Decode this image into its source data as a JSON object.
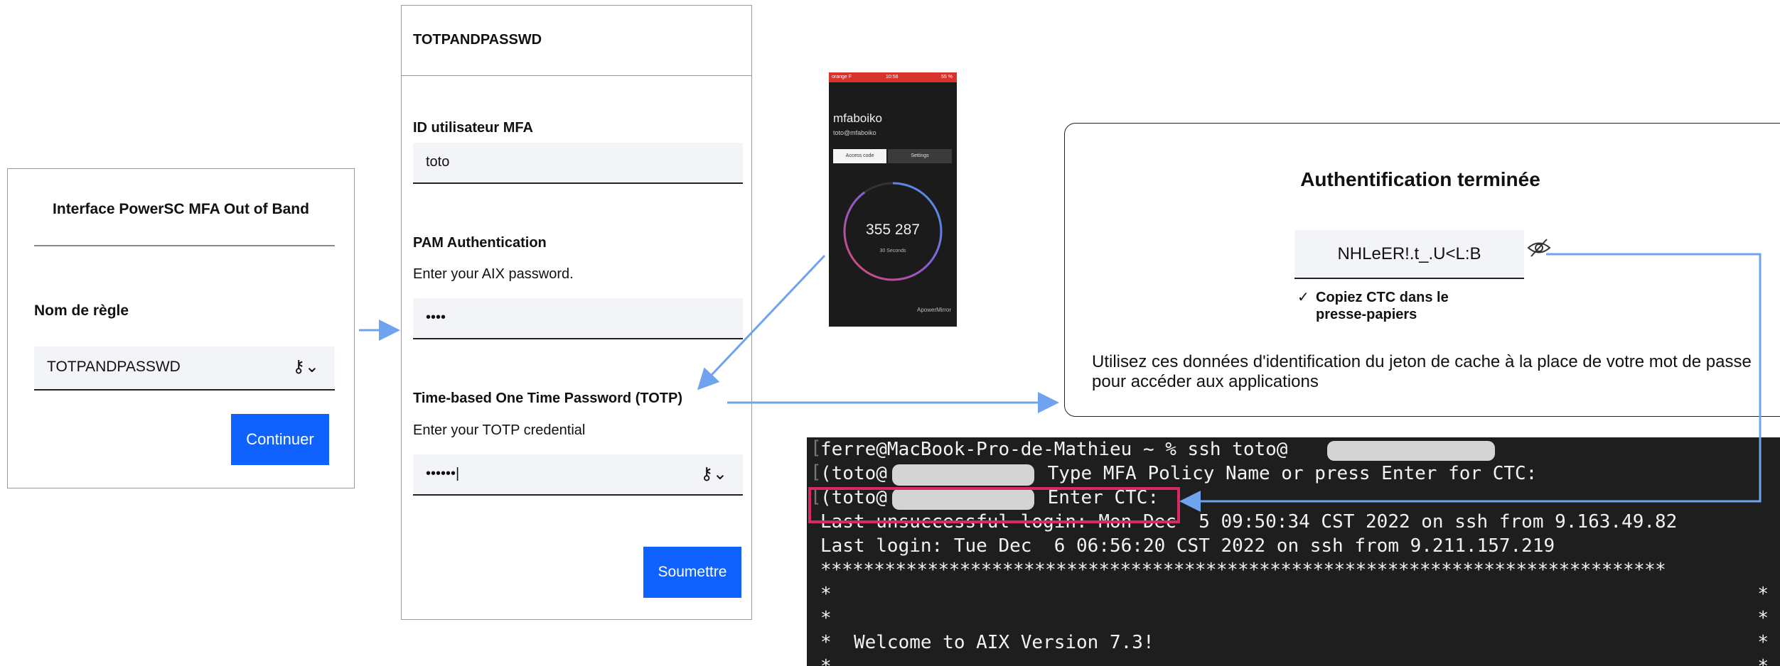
{
  "rule_panel": {
    "title": "Interface PowerSC MFA Out of Band",
    "field_label": "Nom de règle",
    "field_value": "TOTPANDPASSWD",
    "submit_label": "Continuer"
  },
  "auth_panel": {
    "header": "TOTPANDPASSWD",
    "mfa_id_label": "ID utilisateur MFA",
    "mfa_id_value": "toto",
    "pam_label": "PAM Authentication",
    "pam_hint": "Enter your AIX password.",
    "pam_value": "••••",
    "totp_label": "Time-based One Time Password (TOTP)",
    "totp_hint": "Enter your TOTP credential",
    "totp_value": "••••••|",
    "submit_label": "Soumettre"
  },
  "phone": {
    "username": "mfaboiko",
    "email": "toto@mfaboiko",
    "tab_active": "Access code",
    "tab_other": "Settings",
    "code": "355 287",
    "seconds_label": "30 Seconds",
    "brand": "ApowerMirror",
    "countdown_fraction": 0.9
  },
  "done_panel": {
    "title": "Authentification terminée",
    "token": "NHLeER!.t_.U<L:B",
    "copy_label": "Copiez CTC dans le presse-papiers",
    "description": "Utilisez ces données d'identification du jeton de cache à la place de votre mot de passe pour accéder aux applications"
  },
  "terminal": {
    "line1": "ferre@MacBook-Pro-de-Mathieu ~ % ssh toto@",
    "line2a": "(toto@",
    "line2b": " Type MFA Policy Name or press Enter for CTC:",
    "line3a": "(toto@",
    "line3b": " Enter CTC:",
    "line4": "Last unsuccessful login: Mon Dec  5 09:50:34 CST 2022 on ssh from 9.163.49.82",
    "line5": "Last login: Tue Dec  6 06:56:20 CST 2022 on ssh from 9.211.157.219",
    "stars": "*******************************************************************************",
    "star": "*",
    "welcome": "*  Welcome to AIX Version 7.3!"
  },
  "colors": {
    "button_blue": "#0f62fe",
    "arrow_blue": "#6fa3f0",
    "highlight": "#d62a64",
    "terminal_bg": "#1e1e1e"
  }
}
